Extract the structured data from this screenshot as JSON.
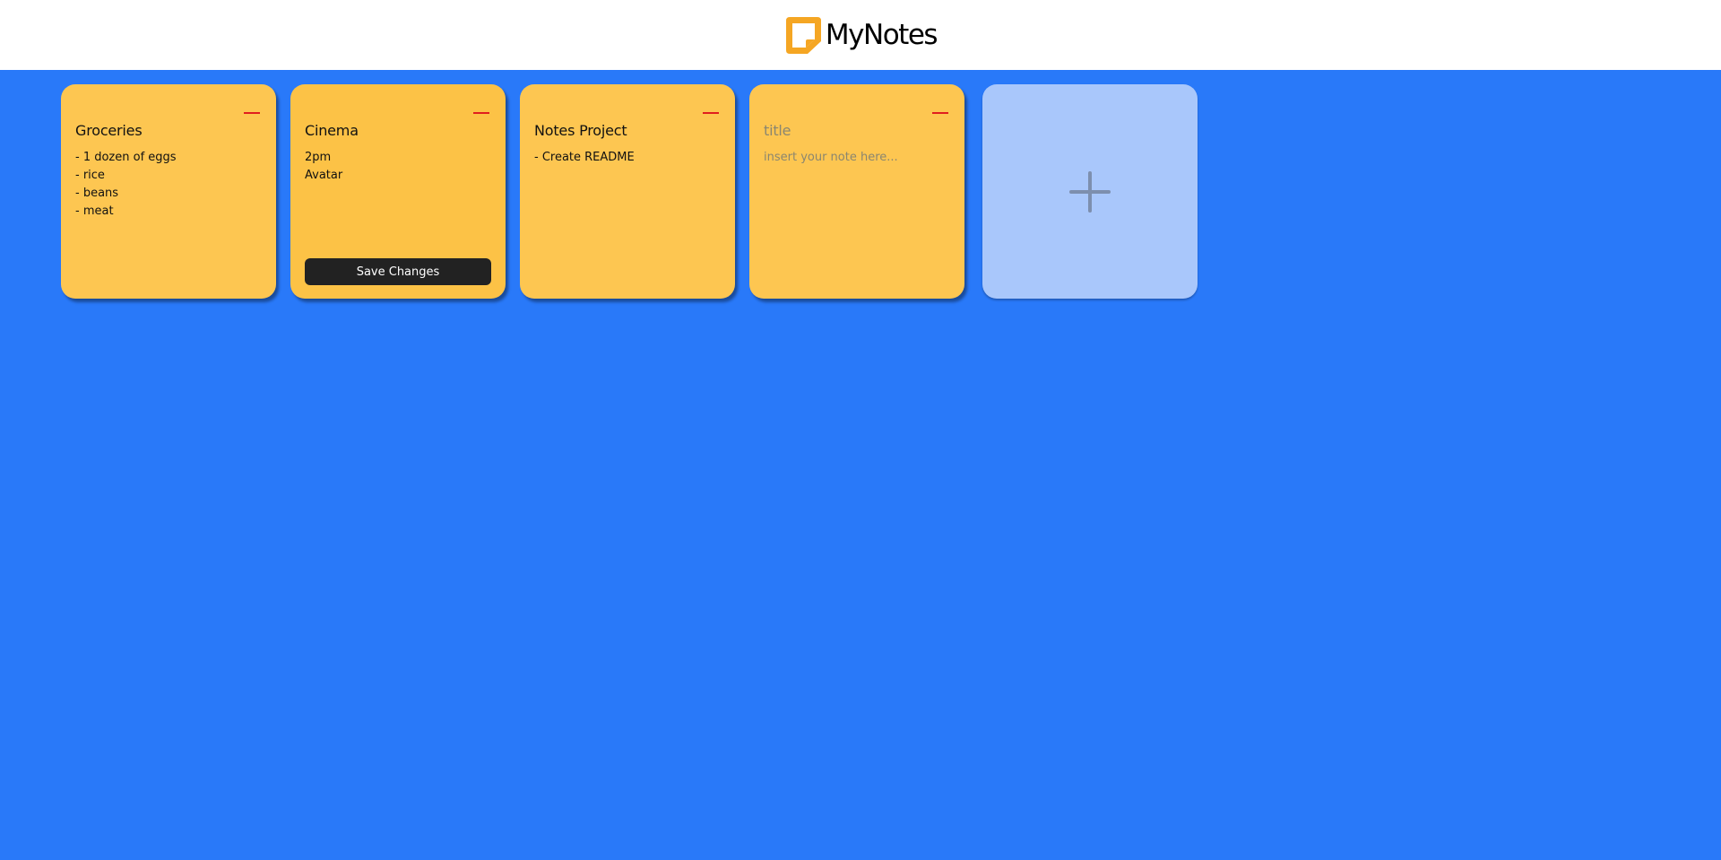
{
  "app": {
    "name": "MyNotes",
    "logo_icon": "sticky-note-icon",
    "logo_color": "#f5a623"
  },
  "notes": [
    {
      "title": "Groceries",
      "lines": [
        "- 1 dozen of eggs",
        "- rice",
        "- beans",
        "- meat"
      ]
    },
    {
      "title": "Cinema",
      "lines": [
        "2pm",
        "Avatar"
      ],
      "save_label": "Save Changes"
    },
    {
      "title": "Notes Project",
      "lines": [
        "- Create README"
      ]
    }
  ],
  "new_note": {
    "title_placeholder": "title",
    "body_placeholder": "insert your note here..."
  },
  "add_button": {
    "icon": "plus-icon"
  },
  "colors": {
    "background": "#2979f9",
    "header": "#ffffff",
    "note": "#fdc651",
    "add_card": "#a9c7fb",
    "delete": "#e01e1e",
    "save_button": "#222222"
  }
}
